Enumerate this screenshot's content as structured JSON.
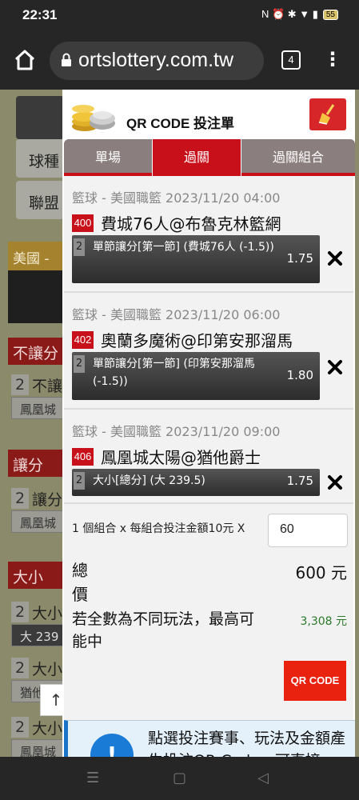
{
  "status": {
    "time": "22:31",
    "icons": "N ⏰ ✱ ▼ ▮",
    "battery": "55"
  },
  "browser": {
    "url": "ortslottery.com.tw",
    "tab_count": "4",
    "menu": "⋮"
  },
  "background": {
    "filters": [
      "球種",
      "聯盟"
    ],
    "section_region": "美國 -",
    "sections": [
      {
        "title": "不讓分",
        "rows": [
          {
            "num": "2",
            "label": "不讓",
            "pill": "鳳凰城"
          }
        ]
      },
      {
        "title": "讓分",
        "rows": [
          {
            "num": "2",
            "label": "讓分",
            "pill": "鳳凰城"
          }
        ]
      },
      {
        "title": "大小",
        "rows": [
          {
            "num": "2",
            "label": "大小",
            "pill": "大 239"
          },
          {
            "num": "2",
            "label": "大小",
            "pill": "猶他"
          },
          {
            "num": "2",
            "label": "大小",
            "pill": "鳳凰城"
          }
        ]
      }
    ],
    "scroll_top": "↑"
  },
  "modal": {
    "title": "QR CODE 投注單",
    "tabs": [
      "單場",
      "過關",
      "過關組合"
    ],
    "active_tab": 1,
    "bets": [
      {
        "meta": "籃球 - 美國職籃 2023/11/20 04:00",
        "code": "400",
        "match": "費城76人@布魯克林籃網",
        "num": "2",
        "option": "單節讓分[第一節] (費城76人 (-1.5))",
        "odds": "1.75"
      },
      {
        "meta": "籃球 - 美國職籃 2023/11/20 06:00",
        "code": "402",
        "match": "奧蘭多魔術@印第安那溜馬",
        "num": "2",
        "option": "單節讓分[第一節] (印第安那溜馬 (-1.5))",
        "odds": "1.80"
      },
      {
        "meta": "籃球 - 美國職籃 2023/11/20 09:00",
        "code": "406",
        "match": "鳳凰城太陽@猶他爵士",
        "num": "2",
        "option": "大小[總分] (大 239.5)",
        "odds": "1.75"
      }
    ],
    "multiplier_text": "1 個組合 x 每組合投注金額10元 X",
    "amount": "60",
    "total_label": "總價",
    "total_value": "600 元",
    "max_label": "若全數為不同玩法，最高可能中",
    "max_value": "3,308 元",
    "qr_button": "QR CODE",
    "info_icon": "!",
    "info_text": "點選投注賽事、玩法及金額產生投注QR Code，可直接"
  },
  "navbar": {
    "recent": "☰",
    "home": "▢",
    "back": "◁"
  },
  "colors": {
    "accent_red": "#c8101a",
    "qr_button": "#e8220f",
    "win_green": "#2a7a2a"
  }
}
